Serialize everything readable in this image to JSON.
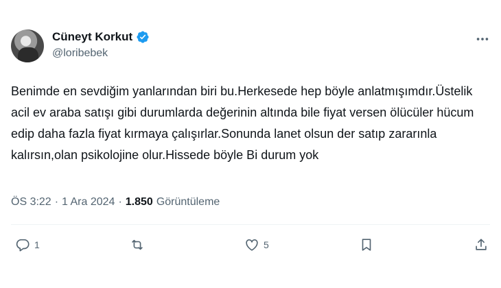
{
  "author": {
    "display_name": "Cüneyt Korkut",
    "handle": "@loribebek",
    "verified_color": "#1d9bf0"
  },
  "tweet": {
    "text": "Benimde en sevdiğim yanlarından biri bu.Herkesede hep böyle anlatmışımdır.Üstelik acil ev araba satışı gibi durumlarda değerinin altında bile fiyat versen ölücüler hücum edip daha fazla fiyat kırmaya çalışırlar.Sonunda lanet olsun der satıp zararınla kalırsın,olan psikolojine olur.Hissede böyle Bi durum yok"
  },
  "meta": {
    "time": "ÖS 3:22",
    "separator1": "·",
    "date": "1 Ara 2024",
    "separator2": "·",
    "views": "1.850",
    "views_label": "Görüntüleme"
  },
  "actions": {
    "reply_count": "1",
    "repost_count": "",
    "like_count": "5"
  },
  "icons": [
    "verified-badge-icon",
    "more-icon",
    "reply-icon",
    "repost-icon",
    "like-icon",
    "bookmark-icon",
    "share-icon"
  ]
}
